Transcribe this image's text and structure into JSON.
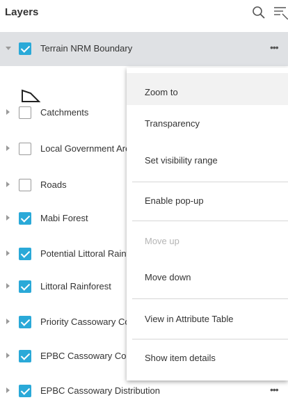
{
  "header": {
    "title": "Layers",
    "search_icon": "search-icon",
    "filter_icon": "filter-list-icon"
  },
  "layers": [
    {
      "label": "Terrain NRM Boundary",
      "checked": true,
      "expanded": true,
      "selected": true,
      "more": "•••"
    },
    {
      "label": "Catchments",
      "checked": false
    },
    {
      "label": "Local Government Areas",
      "checked": false
    },
    {
      "label": "Roads",
      "checked": false
    },
    {
      "label": "Mabi Forest",
      "checked": true
    },
    {
      "label": "Potential Littoral Rainforest",
      "checked": true
    },
    {
      "label": "Littoral Rainforest",
      "checked": true
    },
    {
      "label": "Priority Cassowary Corridors",
      "checked": true
    },
    {
      "label": "EPBC Cassowary Corridors",
      "checked": true
    },
    {
      "label": "EPBC Cassowary Distribution",
      "checked": true,
      "more": "•••"
    }
  ],
  "legend": {
    "symbol": "polygon-outline-icon"
  },
  "context_menu": {
    "items": [
      {
        "label": "Zoom to",
        "state": "hovered"
      },
      {
        "label": "Transparency",
        "state": "normal"
      },
      {
        "label": "Set visibility range",
        "state": "normal"
      },
      {
        "label": "Enable pop-up",
        "state": "normal"
      },
      {
        "label": "Move up",
        "state": "disabled"
      },
      {
        "label": "Move down",
        "state": "normal"
      },
      {
        "label": "View in Attribute Table",
        "state": "normal"
      },
      {
        "label": "Show item details",
        "state": "normal"
      }
    ]
  },
  "colors": {
    "checkbox_checked": "#2aa9d8",
    "selected_row": "#dfe1e4",
    "menu_hover": "#f2f2f2",
    "disabled_text": "#b5b5b5"
  }
}
